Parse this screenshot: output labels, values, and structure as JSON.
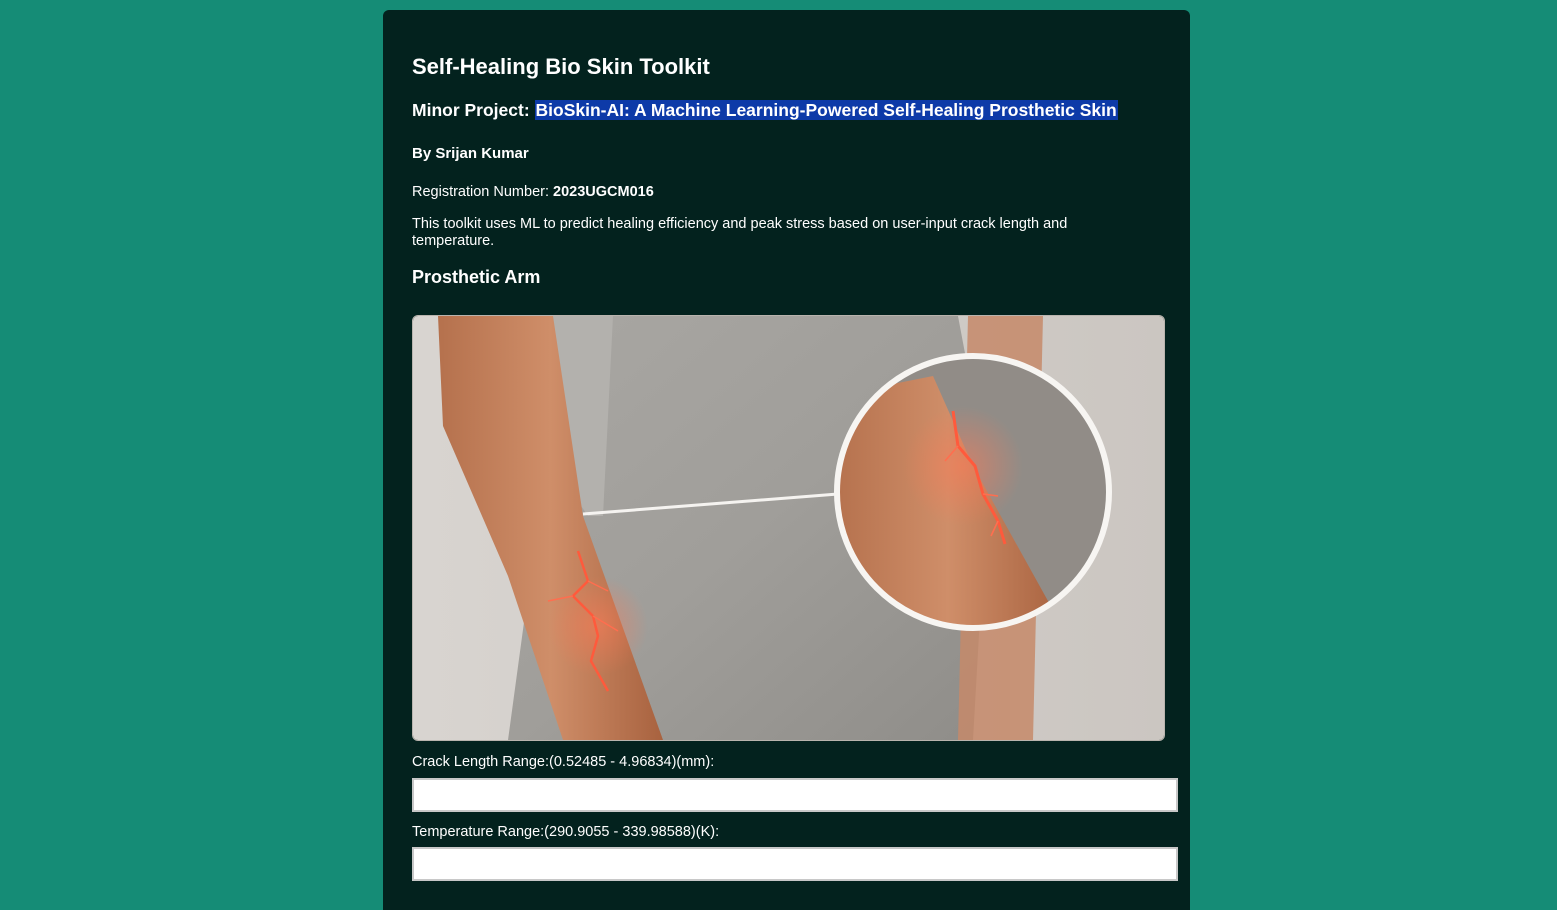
{
  "header": {
    "title": "Self-Healing Bio Skin Toolkit",
    "subtitle_prefix": "Minor Project: ",
    "subtitle_highlight": "BioSkin-AI: A Machine Learning-Powered Self-Healing Prosthetic Skin",
    "byline_prefix": "By ",
    "author": "Srijan Kumar",
    "registration_label": "Registration Number: ",
    "registration_number": "2023UGCM016",
    "description": "This toolkit uses ML to predict healing efficiency and peak stress based on user-input crack length and temperature."
  },
  "section": {
    "title": "Prosthetic Arm"
  },
  "form": {
    "crack_length_label": "Crack Length Range:(0.52485 - 4.96834)(mm):",
    "crack_length_value": "",
    "temperature_label": "Temperature Range:(290.9055 - 339.98588)(K):",
    "temperature_value": ""
  },
  "colors": {
    "page_background": "#158c76",
    "panel_background": "#03221e",
    "highlight": "#0d3aa8",
    "crack_glow": "#ff5a3c"
  }
}
